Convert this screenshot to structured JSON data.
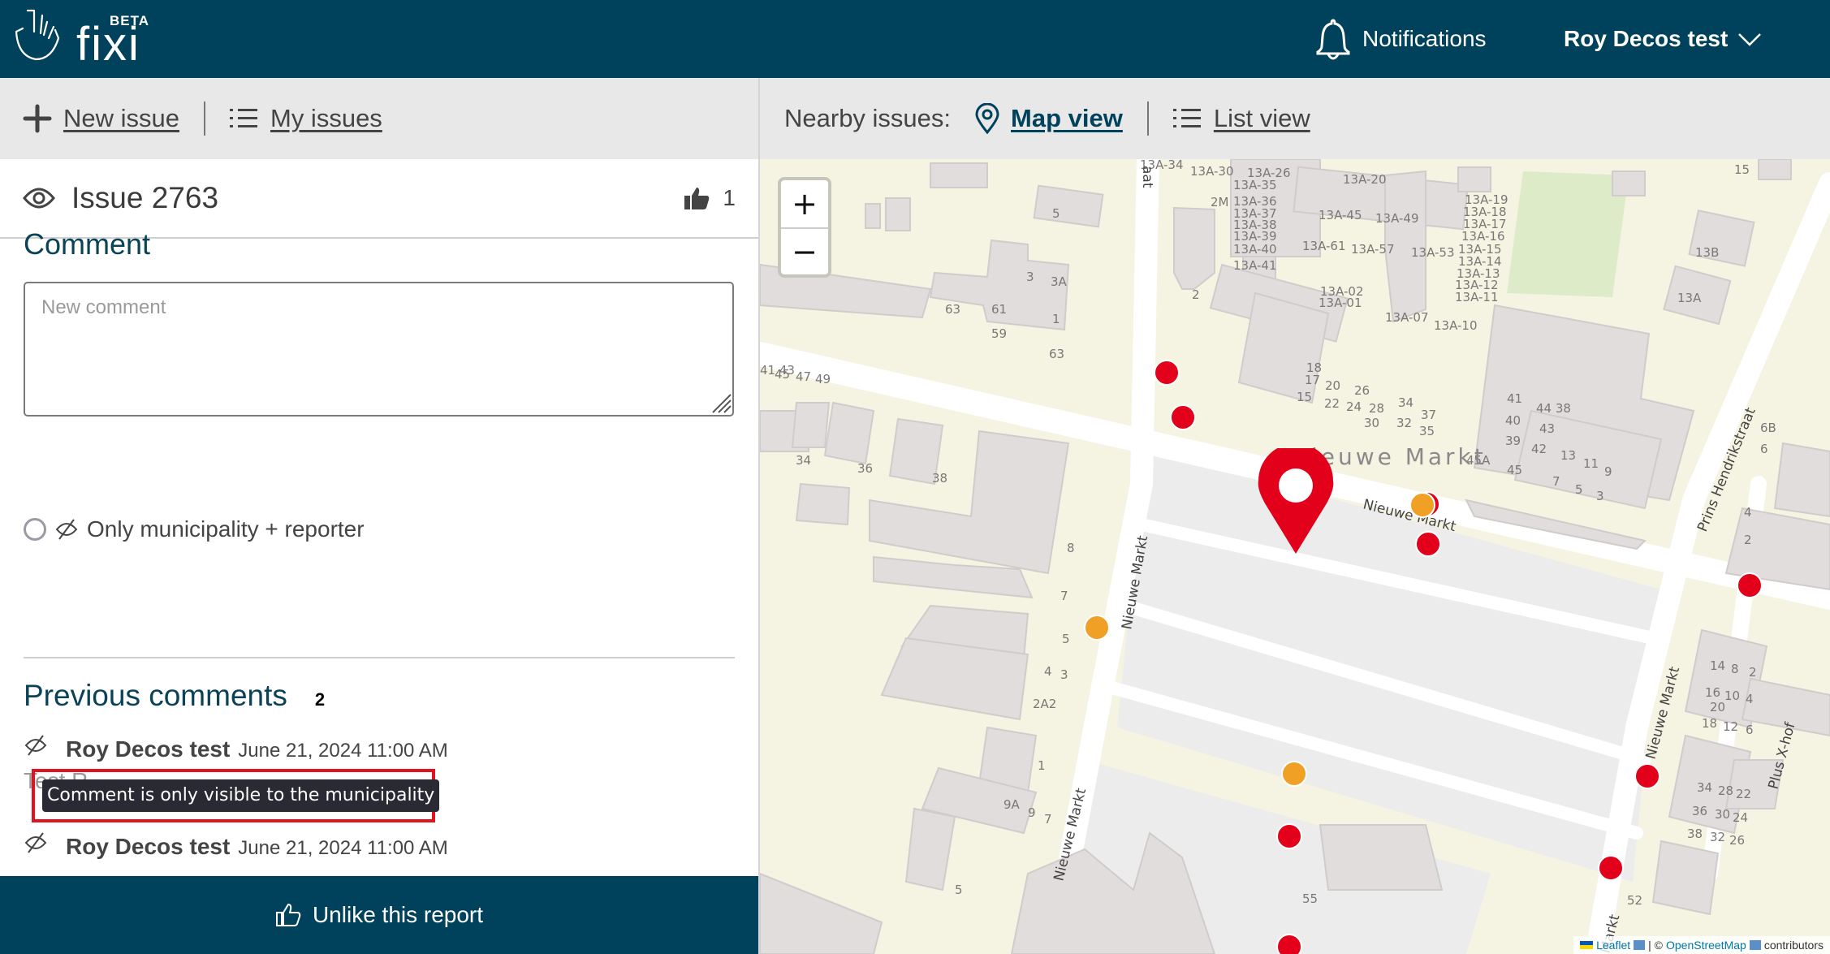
{
  "header": {
    "logo_badge": "BETA",
    "logo_word": "fixi",
    "notifications_label": "Notifications",
    "user_name": "Roy Decos test"
  },
  "left_toolbar": {
    "new_issue_label": "New issue",
    "my_issues_label": "My issues"
  },
  "issue": {
    "title": "Issue 2763",
    "like_count": "1"
  },
  "comment_form": {
    "heading": "Comment",
    "placeholder": "New comment",
    "value": "",
    "visibility_option_label": "Only municipality + reporter",
    "visibility_selected": false
  },
  "previous_comments": {
    "heading": "Previous comments",
    "count": "2",
    "items": [
      {
        "author": "Roy Decos test",
        "date": "June 21, 2024 11:00 AM",
        "text": "Test R",
        "private": true
      },
      {
        "author": "Roy Decos test",
        "date": "June 21, 2024 11:00 AM",
        "text": ".",
        "private": true
      }
    ],
    "tooltip": "Comment is only visible to the municipality"
  },
  "unlike_button_label": "Unlike this report",
  "right_toolbar": {
    "nearby_label": "Nearby issues:",
    "map_view_label": "Map view",
    "list_view_label": "List view",
    "active_view": "map"
  },
  "map": {
    "zoom_in": "+",
    "zoom_out": "−",
    "attribution": {
      "leaflet": "Leaflet",
      "separator": "| ©",
      "osm": "OpenStreetMap",
      "contributors": "contributors"
    },
    "place_label": "Nieuwe Markt",
    "street_labels": [
      "Nieuwe Markt",
      "Nieuwe Markt",
      "Nieuwe Markt",
      "Nieuwe Markt",
      "Nieuwe Markt",
      "Prins Hendrikstraat",
      "Plus X-hof",
      "aat"
    ],
    "house_numbers": [
      "13A-34",
      "13A-30",
      "13A-26",
      "13A-20",
      "13A-35",
      "13A-36",
      "13A-37",
      "13A-38",
      "13A-39",
      "13A-40",
      "13A-41",
      "2M",
      "13A-45",
      "13A-49",
      "13A-61",
      "13A-57",
      "13A-53",
      "13A-19",
      "13A-18",
      "13A-17",
      "13A-16",
      "13A-15",
      "13A-14",
      "13A-13",
      "13A-12",
      "13A-11",
      "13A-10",
      "13A-07",
      "13A-02",
      "13A-01",
      "2",
      "15",
      "13B",
      "13A",
      "6B",
      "6",
      "4",
      "2",
      "41",
      "40",
      "39",
      "45A",
      "45",
      "44",
      "38",
      "43",
      "42",
      "13",
      "11",
      "9",
      "7",
      "5",
      "3",
      "37",
      "35",
      "34",
      "32",
      "28",
      "30",
      "26",
      "24",
      "22",
      "20",
      "18",
      "17",
      "15",
      "5",
      "3",
      "3A",
      "1",
      "63",
      "61",
      "59",
      "63",
      "49",
      "47",
      "45",
      "43",
      "41",
      "39",
      "34",
      "36",
      "38",
      "8",
      "7",
      "5",
      "4",
      "3",
      "2A2",
      "1",
      "9A",
      "9",
      "7",
      "5",
      "55",
      "52",
      "14",
      "8",
      "2",
      "16",
      "10",
      "4",
      "20",
      "18",
      "12",
      "6",
      "34",
      "28",
      "22",
      "36",
      "30",
      "24",
      "38",
      "32",
      "26"
    ],
    "colors": {
      "issue_open": "#e3001b",
      "issue_in_progress": "#f0a024",
      "selected_pin": "#e3001b"
    }
  },
  "colors": {
    "brand": "#00425c",
    "toolbar_bg": "#e8e8e8",
    "heading": "#0a4257"
  }
}
